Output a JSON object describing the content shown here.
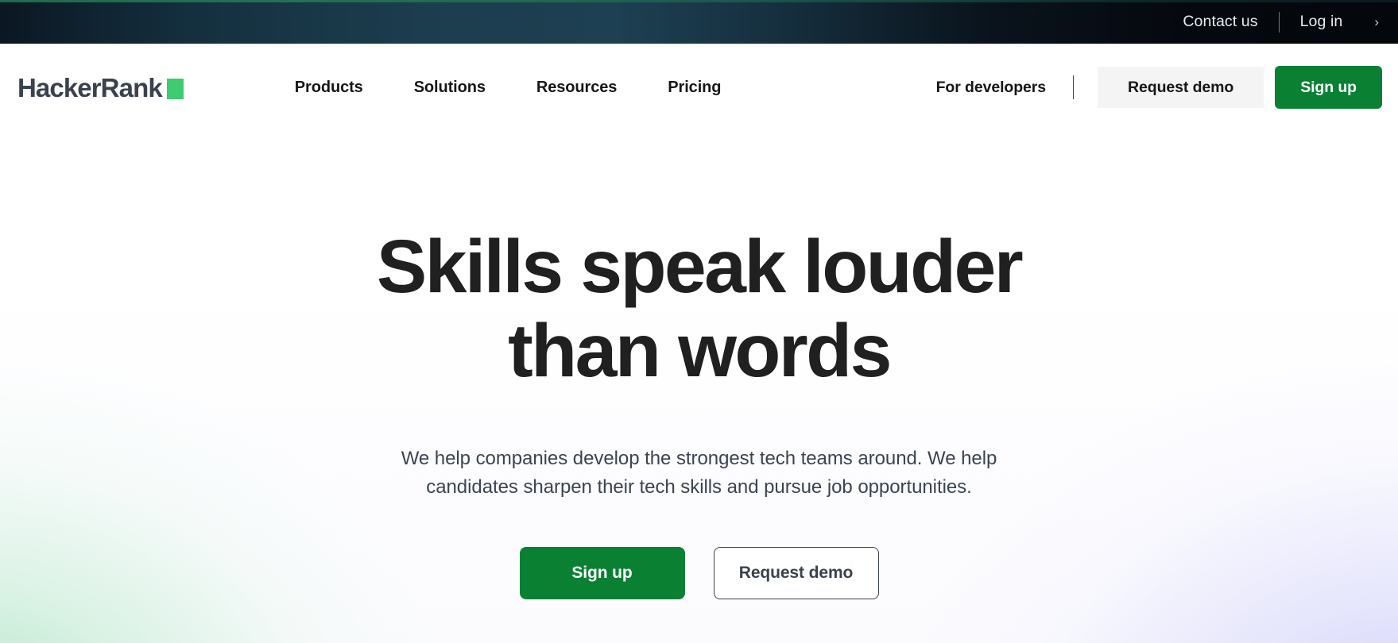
{
  "topbar": {
    "contact_label": "Contact us",
    "login_label": "Log in",
    "chevron_icon": "chevron-right-icon",
    "accent_color": "#1d6b4e",
    "background_start": "#0b1722",
    "background_end": "#04070c"
  },
  "navbar": {
    "logo": {
      "text": "HackerRank",
      "square_color": "#3ecc71",
      "text_color": "#39424e"
    },
    "links": [
      {
        "label": "Products"
      },
      {
        "label": "Solutions"
      },
      {
        "label": "Resources"
      },
      {
        "label": "Pricing"
      }
    ],
    "for_developers_label": "For developers",
    "request_demo_label": "Request demo",
    "sign_up_label": "Sign up",
    "signup_color": "#098032",
    "demo_bg_color": "#f4f4f5"
  },
  "hero": {
    "title_line1": "Skills speak louder",
    "title_line2": "than words",
    "subtitle": "We help companies develop the strongest tech teams around. We help candidates sharpen their tech skills and pursue job opportunities.",
    "sign_up_label": "Sign up",
    "request_demo_label": "Request demo",
    "primary_color": "#098032",
    "outline_color": "#39424e",
    "gradient_left": "#94ddaf",
    "gradient_right": "#afaff7"
  }
}
